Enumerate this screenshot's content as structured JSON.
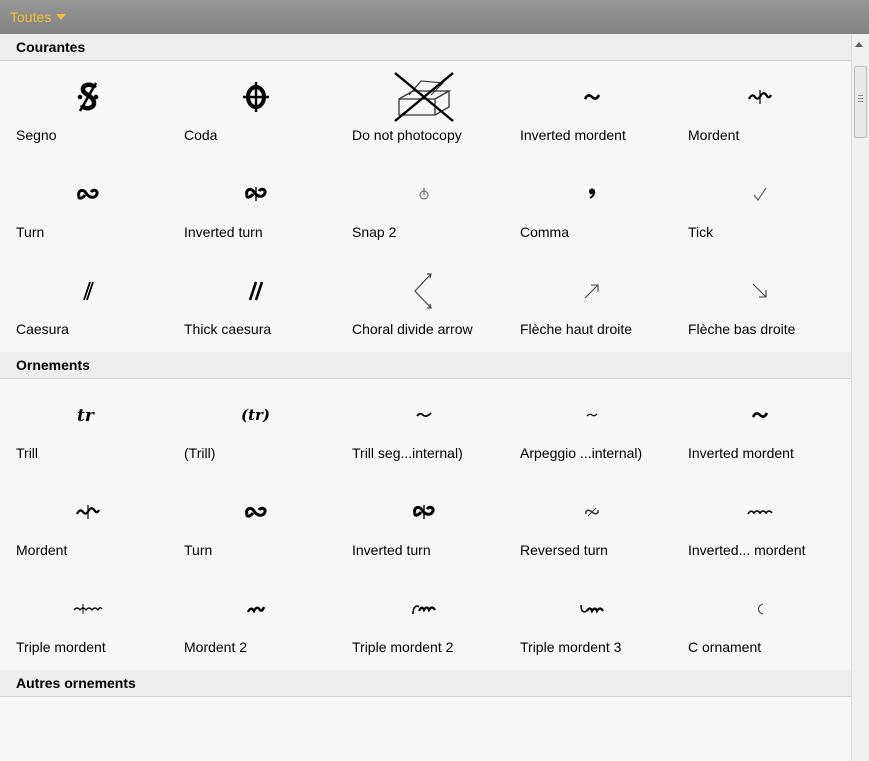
{
  "filter": {
    "label": "Toutes"
  },
  "sections": [
    {
      "title": "Courantes",
      "items": [
        {
          "label": "Segno",
          "icon": "segno-icon"
        },
        {
          "label": "Coda",
          "icon": "coda-icon"
        },
        {
          "label": "Do not photocopy",
          "icon": "do-not-photocopy-icon"
        },
        {
          "label": "Inverted mordent",
          "icon": "inverted-mordent-icon"
        },
        {
          "label": "Mordent",
          "icon": "mordent-icon"
        },
        {
          "label": "Turn",
          "icon": "turn-icon"
        },
        {
          "label": "Inverted turn",
          "icon": "inverted-turn-icon"
        },
        {
          "label": "Snap 2",
          "icon": "snap-pizzicato-icon"
        },
        {
          "label": "Comma",
          "icon": "comma-icon"
        },
        {
          "label": "Tick",
          "icon": "tick-icon"
        },
        {
          "label": "Caesura",
          "icon": "caesura-icon"
        },
        {
          "label": "Thick caesura",
          "icon": "thick-caesura-icon"
        },
        {
          "label": "Choral divide arrow",
          "icon": "choral-divide-arrow-icon"
        },
        {
          "label": "Flèche haut droite",
          "icon": "arrow-up-right-icon"
        },
        {
          "label": "Flèche bas droite",
          "icon": "arrow-down-right-icon"
        }
      ]
    },
    {
      "title": "Ornements",
      "items": [
        {
          "label": "Trill",
          "icon": "trill-icon"
        },
        {
          "label": "(Trill)",
          "icon": "trill-parenthesized-icon"
        },
        {
          "label": "Trill seg...internal)",
          "icon": "trill-segment-icon"
        },
        {
          "label": "Arpeggio ...internal)",
          "icon": "arpeggio-segment-icon"
        },
        {
          "label": "Inverted mordent",
          "icon": "inverted-mordent-icon"
        },
        {
          "label": "Mordent",
          "icon": "mordent-icon"
        },
        {
          "label": "Turn",
          "icon": "turn-icon"
        },
        {
          "label": "Inverted turn",
          "icon": "inverted-turn-icon"
        },
        {
          "label": "Reversed turn",
          "icon": "reversed-turn-icon"
        },
        {
          "label": "Inverted... mordent",
          "icon": "inverted-long-mordent-icon"
        },
        {
          "label": "Triple mordent",
          "icon": "triple-mordent-icon"
        },
        {
          "label": "Mordent 2",
          "icon": "mordent-2-icon"
        },
        {
          "label": "Triple mordent 2",
          "icon": "triple-mordent-2-icon"
        },
        {
          "label": "Triple mordent 3",
          "icon": "triple-mordent-3-icon"
        },
        {
          "label": "C ornament",
          "icon": "c-ornament-icon"
        }
      ]
    },
    {
      "title": "Autres ornements",
      "items": []
    }
  ]
}
